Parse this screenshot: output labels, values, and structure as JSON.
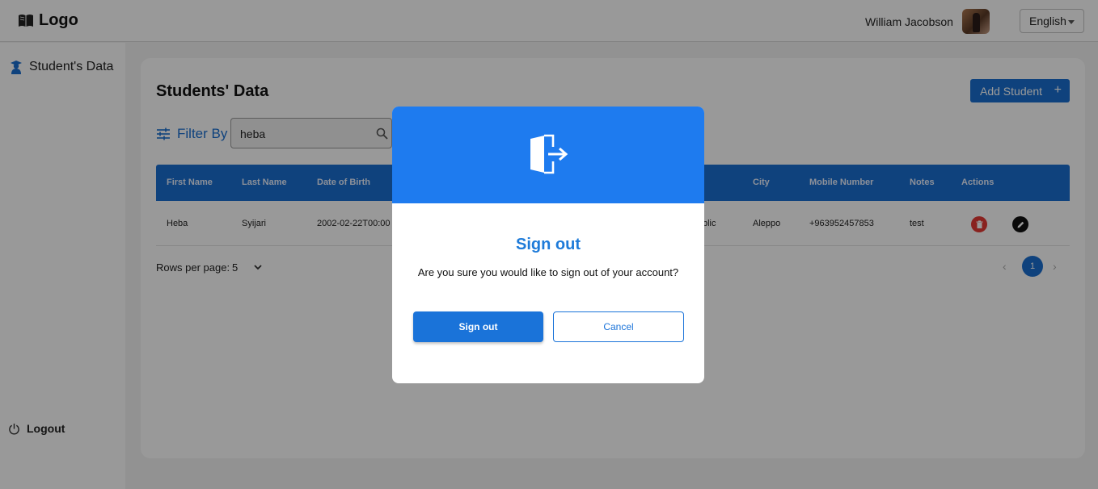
{
  "header": {
    "logo_text": "Logo",
    "user_name": "William Jacobson",
    "language": "English"
  },
  "sidebar": {
    "items": [
      {
        "label": "Student's Data"
      }
    ],
    "logout_label": "Logout"
  },
  "main": {
    "title": "Students' Data",
    "add_button_label": "Add Student",
    "add_button_icon": "+",
    "filter_label": "Filter By",
    "search_value": "heba",
    "table": {
      "columns": [
        "First Name",
        "Last Name",
        "Date of Birth",
        "City",
        "Mobile Number",
        "Notes",
        "Actions"
      ],
      "rows": [
        {
          "first_name": "Heba",
          "last_name": "Syijari",
          "dob": "2002-02-22T00:00",
          "partial": "blic",
          "city": "Aleppo",
          "mobile": "+963952457853",
          "notes": "test"
        }
      ]
    },
    "pagination": {
      "rows_per_page_label": "Rows per page:",
      "rows_per_page_value": "5",
      "current_page": "1",
      "prev": "‹",
      "next": "›"
    }
  },
  "modal": {
    "title": "Sign out",
    "message": "Are you sure you would like to sign out of your account?",
    "confirm_label": "Sign out",
    "cancel_label": "Cancel",
    "icon": "sign-out-door-icon"
  },
  "colors": {
    "primary": "#1a6fd1",
    "modal_header": "#1e7bef",
    "delete": "#e53935"
  }
}
